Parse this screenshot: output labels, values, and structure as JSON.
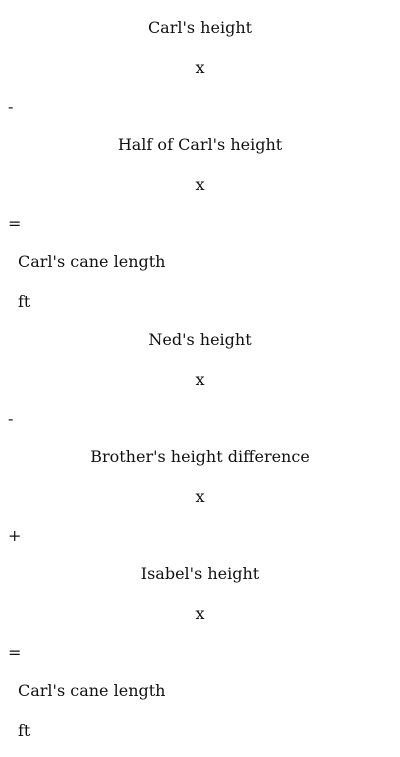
{
  "sections": [
    {
      "term1_label": "Carl's height",
      "term1_var": "x",
      "op1": "-",
      "term2_label": "Half of Carl's height",
      "term2_var": "x",
      "equals": "=",
      "result_label": "Carl's cane length",
      "result_unit": "ft"
    },
    {
      "term1_label": "Ned's height",
      "term1_var": "x",
      "op1": "-",
      "term2_label": "Brother's height difference",
      "term2_var": "x",
      "op2": "+",
      "term3_label": "Isabel's height",
      "term3_var": "x",
      "equals": "=",
      "result_label": "Carl's cane length",
      "result_unit": "ft"
    }
  ]
}
